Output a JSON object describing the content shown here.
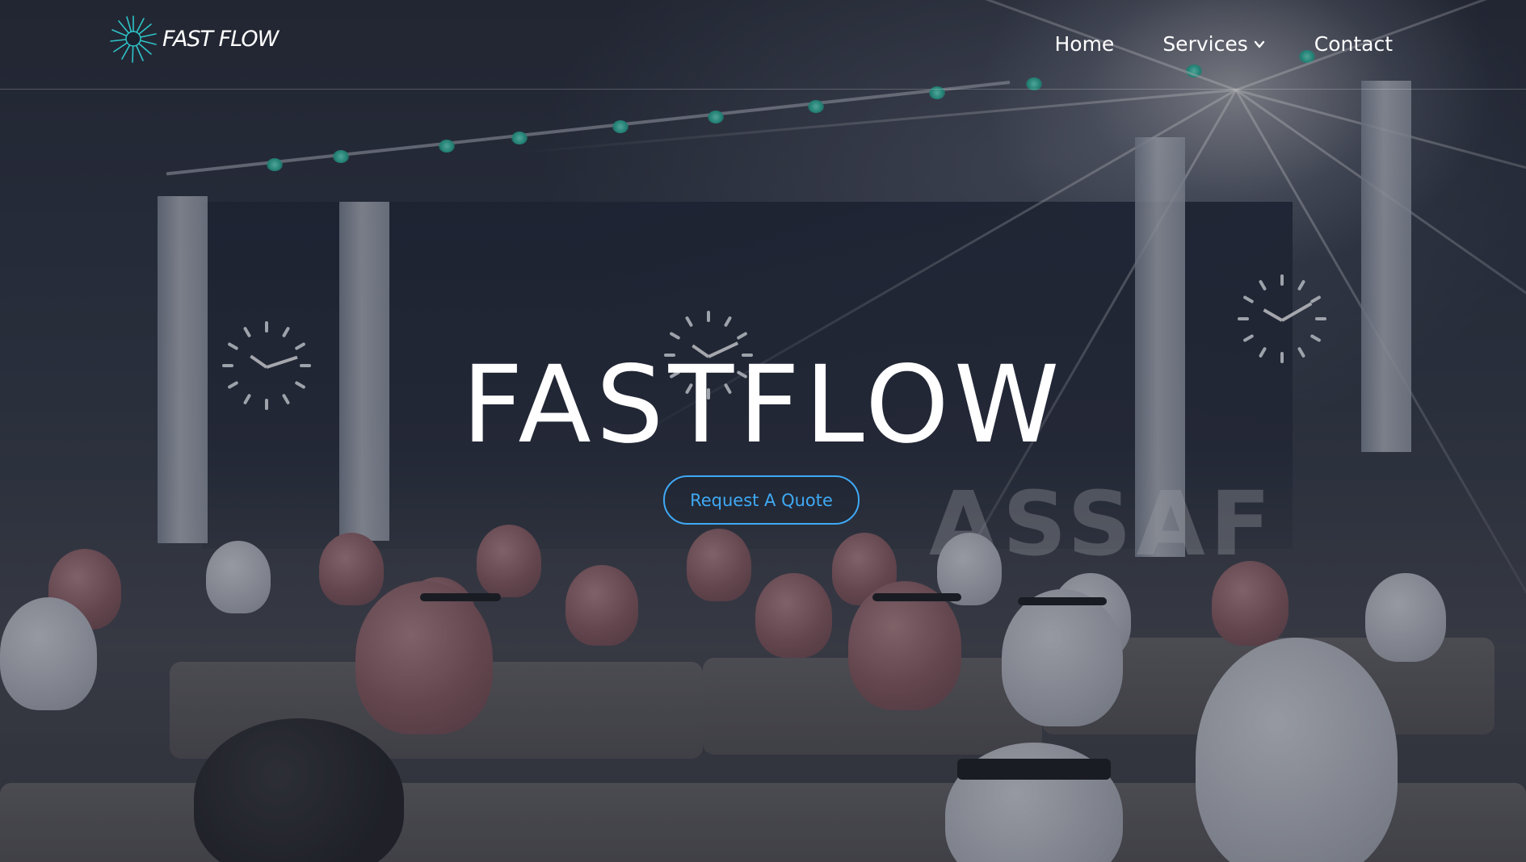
{
  "brand": {
    "logo_text": "FAST FLOW",
    "logo_icon": "starburst-logo-icon",
    "accent": "#3fa9f5",
    "logo_color": "#2ec4c8"
  },
  "nav": {
    "items": [
      {
        "label": "Home",
        "icon": null
      },
      {
        "label": "Services",
        "icon": "chevron-down-icon"
      },
      {
        "label": "Contact",
        "icon": null
      }
    ]
  },
  "hero": {
    "title": "FASTFLOW",
    "cta_label": "Request A Quote",
    "background_sign": "ASSAF"
  }
}
